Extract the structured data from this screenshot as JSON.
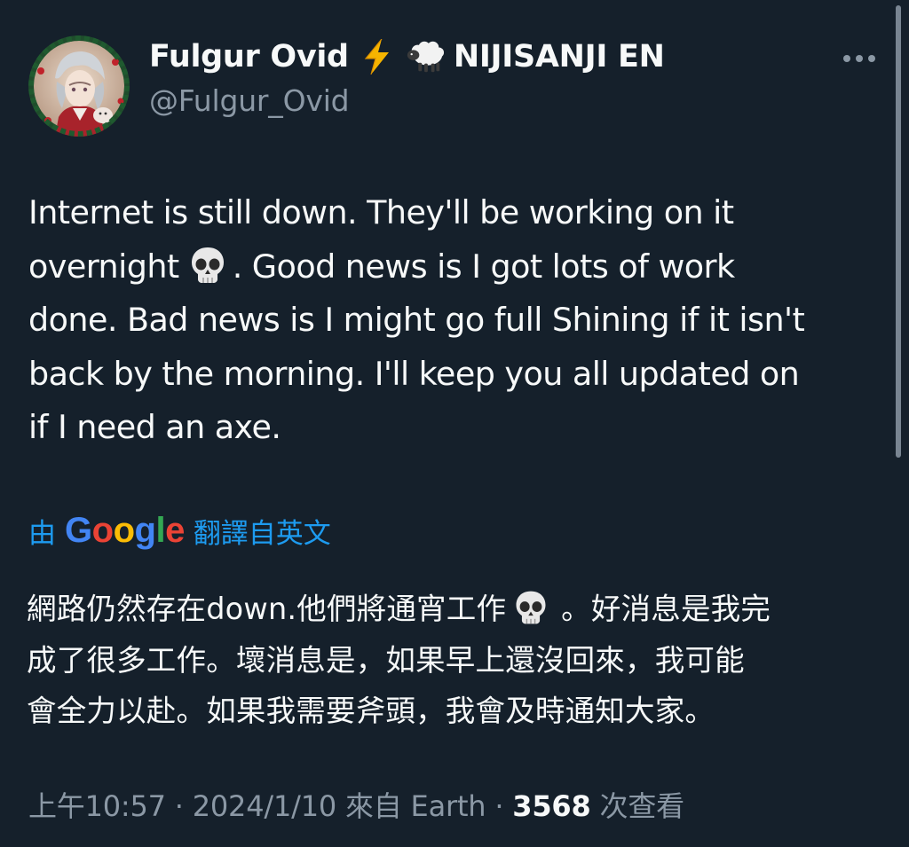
{
  "author": {
    "display_name": "Fulgur Ovid",
    "affiliation": "NIJISANJI EN",
    "handle": "@Fulgur_Ovid",
    "badge_icons": [
      "lightning-bolt-icon",
      "sheep-icon"
    ]
  },
  "tweet": {
    "line_1": "Internet is still down. They'll be working on it",
    "line_2_before": "overnight",
    "line_2_after": ". Good news is I got lots of work",
    "line_3": "done. Bad news is I might go full Shining if it isn't",
    "line_4": "back by the morning. I'll keep you all updated on",
    "line_5": "if I need an axe.",
    "emoji": "skull-emoji"
  },
  "translation": {
    "prefix": "由",
    "provider": "Google",
    "suffix": "翻譯自英文",
    "line_1_before": "網路仍然存在down.他們將通宵工作",
    "line_1_after": "。好消息是我完",
    "line_2": "成了很多工作。壞消息是，如果早上還沒回來，我可能",
    "line_3": "會全力以赴。如果我需要斧頭，我會及時通知大家。"
  },
  "meta": {
    "time_date": "上午10:57 · 2024/1/10 來自 Earth · ",
    "view_count": "3568",
    "views_label": " 次查看"
  },
  "colors": {
    "background": "#15202b",
    "text": "#f7f9f9",
    "secondary": "#8b98a5",
    "link": "#1d9bf0"
  }
}
